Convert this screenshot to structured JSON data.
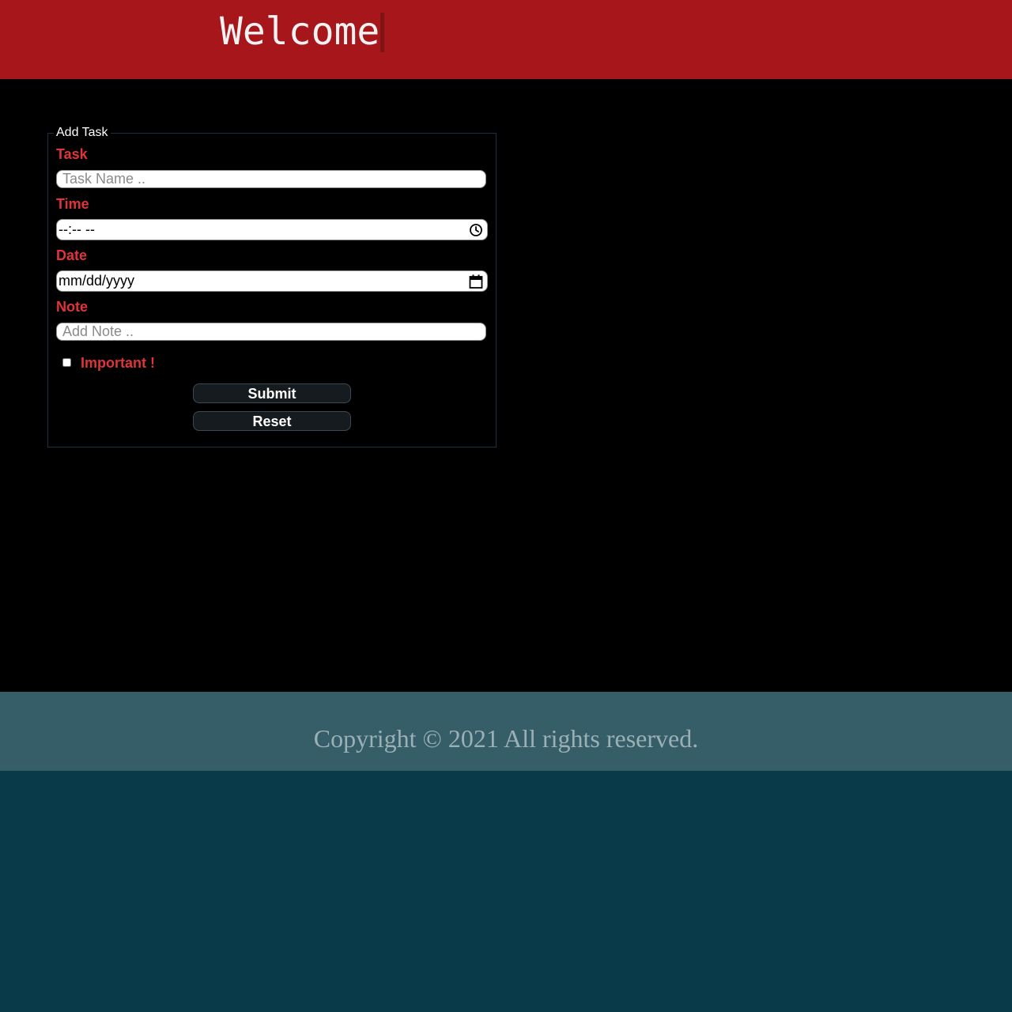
{
  "header": {
    "title": "Welcome",
    "background": "#a6161b"
  },
  "form": {
    "legend": "Add Task",
    "task": {
      "label": "Task",
      "placeholder": "Task Name .."
    },
    "time": {
      "label": "Time",
      "value": "--:-- --",
      "icon": "clock-icon"
    },
    "date": {
      "label": "Date",
      "value": "mm/dd/yyyy",
      "icon": "calendar-icon"
    },
    "note": {
      "label": "Note",
      "placeholder": "Add Note .."
    },
    "important": {
      "label": "Important !",
      "checked": false
    },
    "buttons": {
      "submit": "Submit",
      "reset": "Reset"
    },
    "label_color": "#e0343a"
  },
  "footer": {
    "text": "Copyright © 2021 All rights reserved.",
    "background": "#355e68"
  }
}
